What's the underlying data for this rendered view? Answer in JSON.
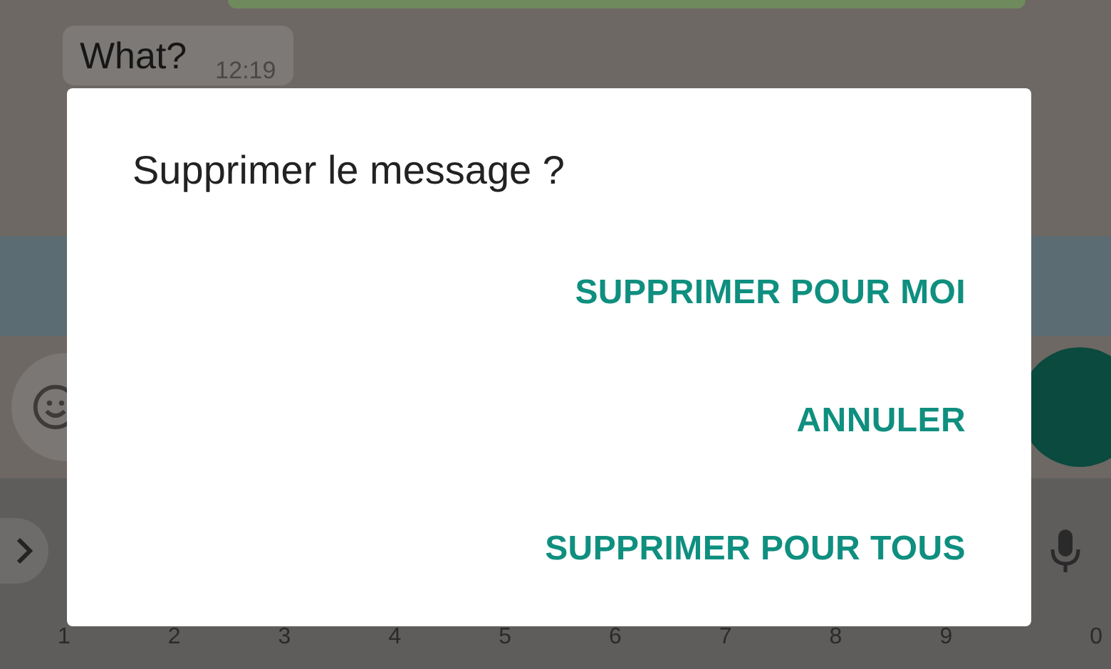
{
  "chat": {
    "messages": [
      {
        "text": "What?",
        "time": "12:19"
      }
    ]
  },
  "dialog": {
    "title": "Supprimer le message ?",
    "buttons": [
      {
        "label": "SUPPRIMER POUR MOI"
      },
      {
        "label": "ANNULER"
      },
      {
        "label": "SUPPRIMER POUR TOUS"
      }
    ]
  },
  "keyboard": {
    "number_hints": [
      "1",
      "2",
      "3",
      "4",
      "5",
      "6",
      "7",
      "8",
      "9",
      "0"
    ]
  }
}
